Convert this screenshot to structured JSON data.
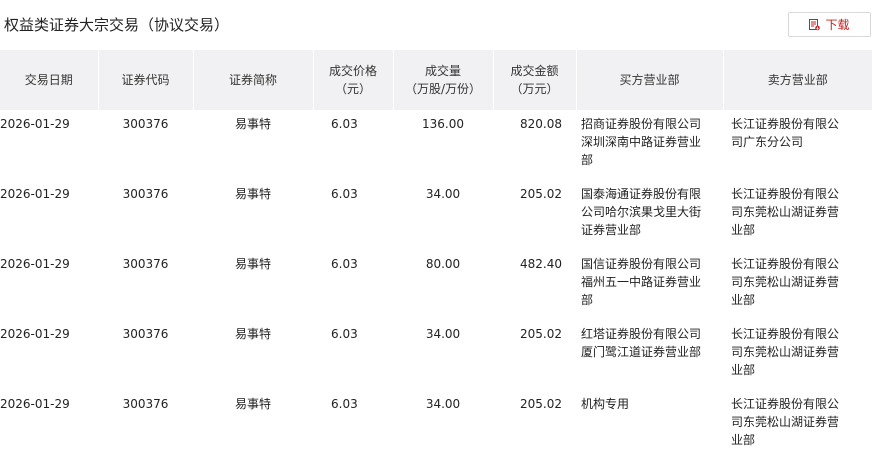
{
  "page": {
    "title": "权益类证券大宗交易（协议交易）",
    "download_label": "下载"
  },
  "table": {
    "headers": [
      "交易日期",
      "证券代码",
      "证券简称",
      "成交价格\n（元）",
      "成交量\n（万股/万份）",
      "成交金额\n（万元）",
      "买方营业部",
      "卖方营业部"
    ],
    "rows": [
      [
        "2026-01-29",
        "300376",
        "易事特",
        "6.03",
        "136.00",
        "820.08",
        "招商证券股份有限公司深圳深南中路证券营业部",
        "长江证券股份有限公司广东分公司"
      ],
      [
        "2026-01-29",
        "300376",
        "易事特",
        "6.03",
        "34.00",
        "205.02",
        "国泰海通证券股份有限公司哈尔滨果戈里大街证券营业部",
        "长江证券股份有限公司东莞松山湖证券营业部"
      ],
      [
        "2026-01-29",
        "300376",
        "易事特",
        "6.03",
        "80.00",
        "482.40",
        "国信证券股份有限公司福州五一中路证券营业部",
        "长江证券股份有限公司东莞松山湖证券营业部"
      ],
      [
        "2026-01-29",
        "300376",
        "易事特",
        "6.03",
        "34.00",
        "205.02",
        "红塔证券股份有限公司厦门鹭江道证券营业部",
        "长江证券股份有限公司东莞松山湖证券营业部"
      ],
      [
        "2026-01-29",
        "300376",
        "易事特",
        "6.03",
        "34.00",
        "205.02",
        "机构专用",
        "长江证券股份有限公司东莞松山湖证券营业部"
      ]
    ]
  },
  "colors": {
    "header_bg": "#f1f1f3",
    "accent": "#c81e1e"
  },
  "icons": {
    "download": "download-icon"
  }
}
